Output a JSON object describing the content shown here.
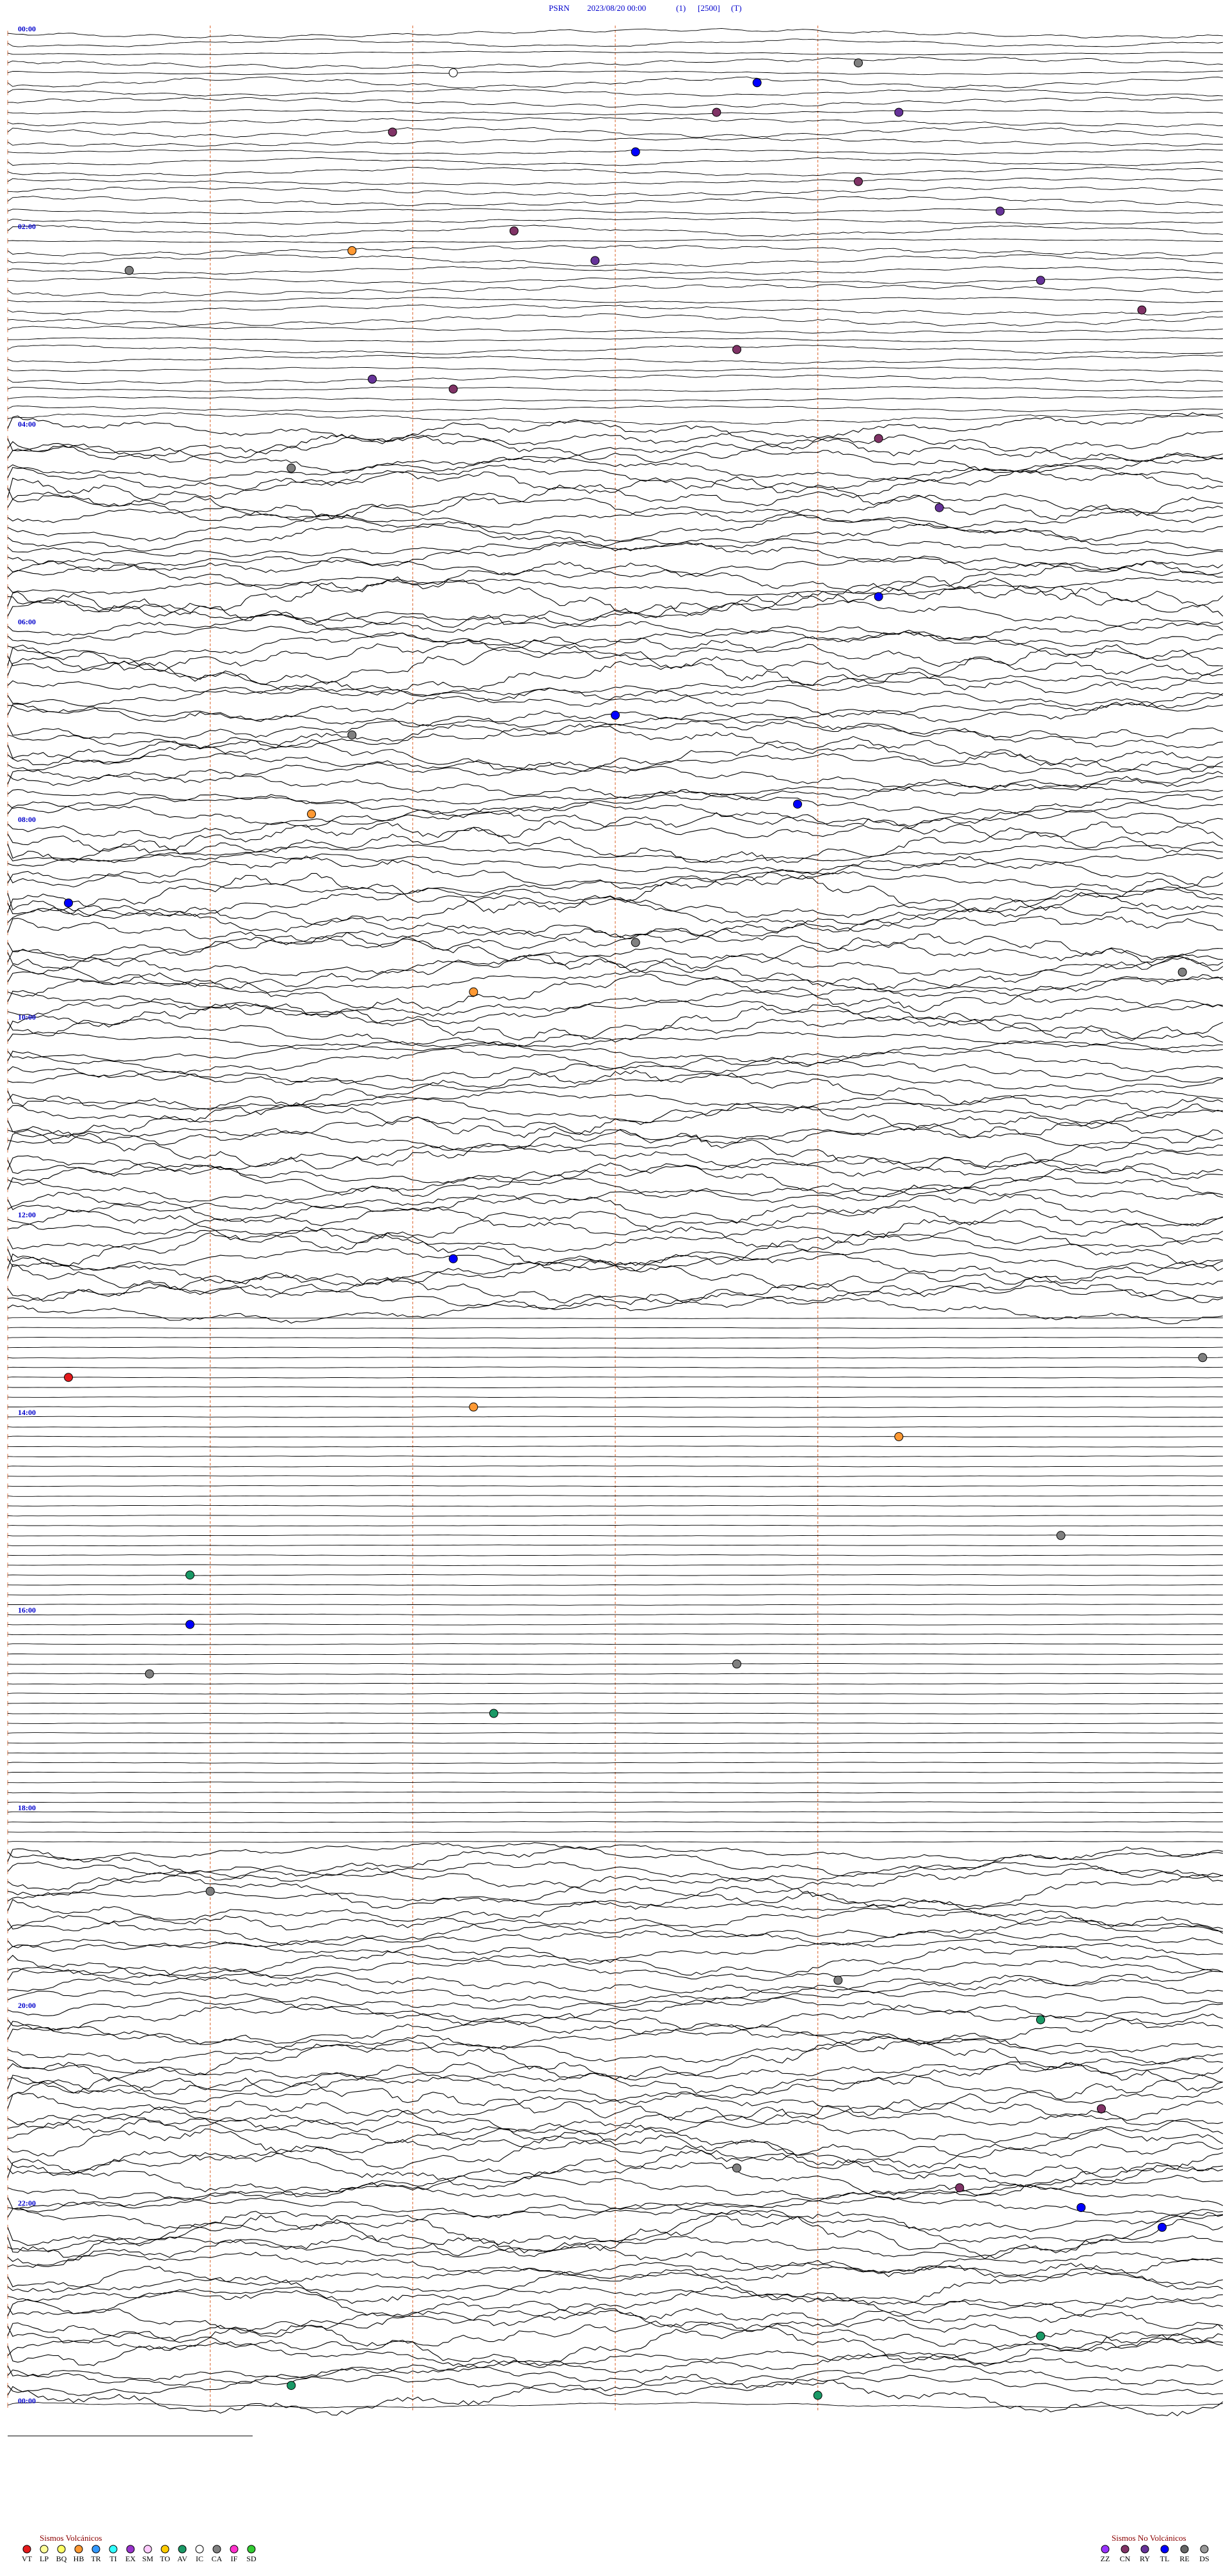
{
  "header": {
    "station": "PSRN",
    "datetime": "2023/08/20 00:00",
    "channel": "(1)",
    "gain": "[2500]",
    "flag": "(T)"
  },
  "chart_data": {
    "type": "line",
    "title": "PSRN 2023/08/20 00:00 (1) [2500] (T)",
    "time_labels": [
      "00:00",
      "02:00",
      "04:00",
      "06:00",
      "08:00",
      "10:00",
      "12:00",
      "14:00",
      "16:00",
      "18:00",
      "20:00",
      "22:00",
      "00:00"
    ],
    "traces_per_block": 20,
    "trace_count": 241,
    "minutes_per_trace": 6,
    "noise_bands": [
      {
        "from_trace": 40,
        "to_trace": 130,
        "level": "high"
      },
      {
        "from_trace": 130,
        "to_trace": 184,
        "level": "quiet"
      },
      {
        "from_trace": 184,
        "to_trace": 240,
        "level": "high"
      }
    ],
    "events": [
      {
        "trace": 3,
        "minute": 4.2,
        "type": "CA"
      },
      {
        "trace": 4,
        "minute": 2.2,
        "type": "IC"
      },
      {
        "trace": 5,
        "minute": 3.7,
        "type": "TL"
      },
      {
        "trace": 8,
        "minute": 3.5,
        "type": "CN"
      },
      {
        "trace": 8,
        "minute": 4.4,
        "type": "RY"
      },
      {
        "trace": 10,
        "minute": 1.9,
        "type": "CN"
      },
      {
        "trace": 12,
        "minute": 3.1,
        "type": "TL"
      },
      {
        "trace": 15,
        "minute": 4.2,
        "type": "CN"
      },
      {
        "trace": 18,
        "minute": 4.9,
        "type": "RY"
      },
      {
        "trace": 20,
        "minute": 2.5,
        "type": "CN"
      },
      {
        "trace": 22,
        "minute": 1.7,
        "type": "HB"
      },
      {
        "trace": 23,
        "minute": 2.9,
        "type": "RY"
      },
      {
        "trace": 24,
        "minute": 0.6,
        "type": "CA"
      },
      {
        "trace": 25,
        "minute": 5.1,
        "type": "RY"
      },
      {
        "trace": 28,
        "minute": 5.6,
        "type": "CN"
      },
      {
        "trace": 32,
        "minute": 3.6,
        "type": "CN"
      },
      {
        "trace": 35,
        "minute": 1.8,
        "type": "RY"
      },
      {
        "trace": 36,
        "minute": 2.2,
        "type": "CN"
      },
      {
        "trace": 41,
        "minute": 4.3,
        "type": "CN"
      },
      {
        "trace": 44,
        "minute": 1.4,
        "type": "CA"
      },
      {
        "trace": 48,
        "minute": 4.6,
        "type": "RY"
      },
      {
        "trace": 57,
        "minute": 4.3,
        "type": "TL"
      },
      {
        "trace": 69,
        "minute": 3.0,
        "type": "TL"
      },
      {
        "trace": 71,
        "minute": 1.7,
        "type": "CA"
      },
      {
        "trace": 78,
        "minute": 3.9,
        "type": "TL"
      },
      {
        "trace": 79,
        "minute": 1.5,
        "type": "HB"
      },
      {
        "trace": 88,
        "minute": 0.3,
        "type": "TL"
      },
      {
        "trace": 92,
        "minute": 3.1,
        "type": "CA"
      },
      {
        "trace": 95,
        "minute": 5.8,
        "type": "CA"
      },
      {
        "trace": 97,
        "minute": 2.3,
        "type": "HB"
      },
      {
        "trace": 124,
        "minute": 2.2,
        "type": "TL"
      },
      {
        "trace": 134,
        "minute": 5.9,
        "type": "CA"
      },
      {
        "trace": 136,
        "minute": 0.3,
        "type": "VT"
      },
      {
        "trace": 139,
        "minute": 2.3,
        "type": "HB"
      },
      {
        "trace": 142,
        "minute": 4.4,
        "type": "HB"
      },
      {
        "trace": 152,
        "minute": 5.2,
        "type": "CA"
      },
      {
        "trace": 156,
        "minute": 0.9,
        "type": "AV"
      },
      {
        "trace": 161,
        "minute": 0.9,
        "type": "TL"
      },
      {
        "trace": 165,
        "minute": 3.6,
        "type": "CA"
      },
      {
        "trace": 166,
        "minute": 0.7,
        "type": "CA"
      },
      {
        "trace": 170,
        "minute": 2.4,
        "type": "AV"
      },
      {
        "trace": 188,
        "minute": 1.0,
        "type": "CA"
      },
      {
        "trace": 197,
        "minute": 4.1,
        "type": "CA"
      },
      {
        "trace": 201,
        "minute": 5.1,
        "type": "AV"
      },
      {
        "trace": 210,
        "minute": 5.4,
        "type": "CN"
      },
      {
        "trace": 216,
        "minute": 3.6,
        "type": "CA"
      },
      {
        "trace": 218,
        "minute": 4.7,
        "type": "CN"
      },
      {
        "trace": 220,
        "minute": 5.3,
        "type": "TL"
      },
      {
        "trace": 222,
        "minute": 5.7,
        "type": "TL"
      },
      {
        "trace": 233,
        "minute": 5.1,
        "type": "AV"
      },
      {
        "trace": 238,
        "minute": 1.4,
        "type": "AV"
      },
      {
        "trace": 239,
        "minute": 4.0,
        "type": "AV"
      }
    ]
  },
  "legend": {
    "volcanic_title": "Sismos Volcánicos",
    "nonvolcanic_title": "Sismos No Volcánicos",
    "volcanic": [
      {
        "code": "VT",
        "color": "#e41a1c"
      },
      {
        "code": "LP",
        "color": "#ffff99"
      },
      {
        "code": "BQ",
        "color": "#ffff66"
      },
      {
        "code": "HB",
        "color": "#ff9933"
      },
      {
        "code": "TR",
        "color": "#3399ff"
      },
      {
        "code": "TI",
        "color": "#33ffff"
      },
      {
        "code": "EX",
        "color": "#9933cc"
      },
      {
        "code": "SM",
        "color": "#ffccff"
      },
      {
        "code": "TO",
        "color": "#ffcc00"
      },
      {
        "code": "AV",
        "color": "#1a9966"
      },
      {
        "code": "IC",
        "color": "#ffffff"
      },
      {
        "code": "CA",
        "color": "#808080"
      },
      {
        "code": "IF",
        "color": "#ff33cc"
      },
      {
        "code": "SD",
        "color": "#33cc33"
      }
    ],
    "nonvolcanic": [
      {
        "code": "ZZ",
        "color": "#9933ff"
      },
      {
        "code": "CN",
        "color": "#803366"
      },
      {
        "code": "RY",
        "color": "#663399"
      },
      {
        "code": "TL",
        "color": "#0000ff"
      },
      {
        "code": "RE",
        "color": "#666666"
      },
      {
        "code": "DS",
        "color": "#999999"
      }
    ]
  },
  "colors": {
    "trace": "#000000",
    "time_marker": "#e07a4a",
    "label": "#0000cc"
  }
}
